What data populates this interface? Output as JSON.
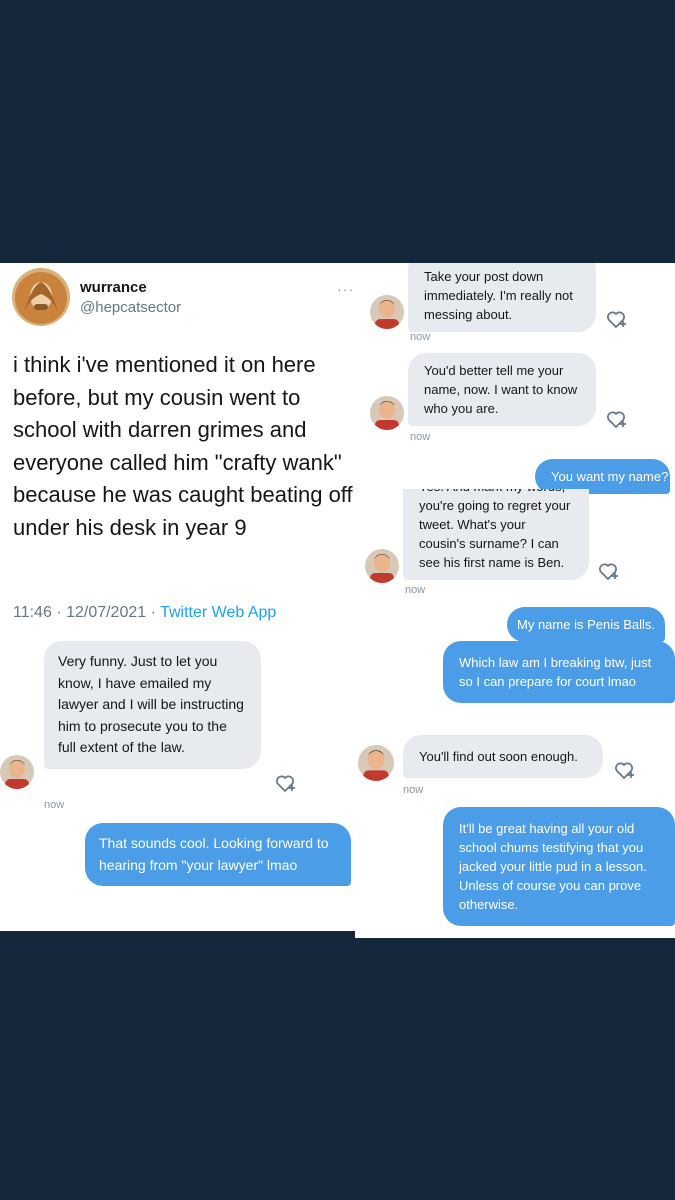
{
  "tweet": {
    "author_name": "wurrance",
    "author_handle": "@hepcatsector",
    "more": "···",
    "text": "i think i've mentioned it on here before, but my cousin went to school with darren grimes and everyone called him \"crafty wank\" because he was caught beating off under his desk in year 9",
    "time_date": "11:46 · 12/07/2021 · ",
    "app": "Twitter Web App"
  },
  "tweet_panel_dm": [
    {
      "type": "in",
      "text": "Very funny. Just to let you know, I have emailed my lawyer and I will be instructing him to prosecute you to the full extent of the law.",
      "time": "now"
    },
    {
      "type": "out",
      "text": "That sounds cool. Looking forward to hearing from \"your lawyer\" lmao"
    }
  ],
  "dm_panel": [
    {
      "type": "in",
      "text": "Take your post down immediately. I'm really not messing about.",
      "time": "now"
    },
    {
      "type": "in",
      "text": "You'd better tell me your name, now. I want to know who you are.",
      "time": "now"
    },
    {
      "type": "out",
      "text": "You want my name?"
    },
    {
      "type": "in",
      "text": "Yes. And mark my words, you're going to regret your tweet. What's your cousin's surname? I can see his first name is Ben.",
      "time": "now"
    },
    {
      "type": "out",
      "text": "My name is Penis Balls."
    },
    {
      "type": "out",
      "text": "Which law am I breaking btw, just so I can prepare for court lmao"
    },
    {
      "type": "in",
      "text": "You'll find out soon enough.",
      "time": "now"
    },
    {
      "type": "out",
      "text": "It'll be great having all your old school chums testifying that you jacked your little pud in a lesson. Unless of course you can prove otherwise."
    }
  ],
  "icons": {
    "react": "heart-plus-icon",
    "more": "more-icon",
    "avatar_author": "avatar-author",
    "avatar_sender": "avatar-sender"
  },
  "colors": {
    "background": "#15273b",
    "incoming_bubble": "#e7eaee",
    "outgoing_bubble": "#4b9de8",
    "link": "#1da1f2"
  }
}
